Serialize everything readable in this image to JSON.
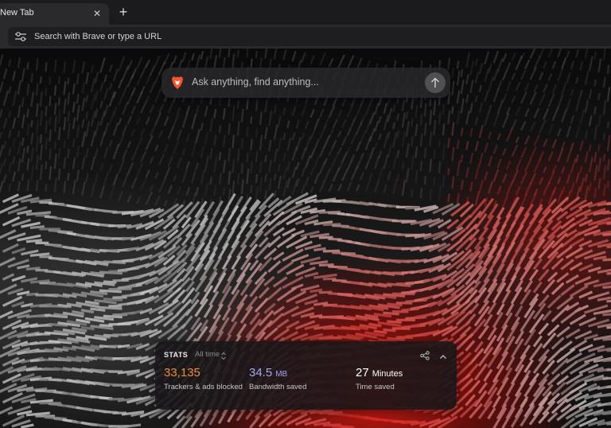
{
  "tab": {
    "title": "New Tab",
    "close_glyph": "✕",
    "new_tab_glyph": "+"
  },
  "address_bar": {
    "placeholder": "Search with Brave or type a URL",
    "icon": "site-settings-icon"
  },
  "search": {
    "placeholder": "Ask anything, find anything...",
    "logo_icon": "brave-logo-icon",
    "submit_icon": "arrow-up-icon"
  },
  "stats": {
    "heading": "STATS",
    "range": "All time",
    "items": [
      {
        "value": "33,135",
        "unit": "",
        "label": "Trackers & ads blocked",
        "color": "#f08a3a"
      },
      {
        "value": "34.5",
        "unit": "MB",
        "label": "Bandwidth saved",
        "color": "#a7a4f2"
      },
      {
        "value": "27",
        "unit": "Minutes",
        "label": "Time saved",
        "color": "#ffffff"
      }
    ],
    "share_icon": "share-icon",
    "collapse_icon": "chevron-up-icon"
  },
  "colors": {
    "accent_red": "#e0261a",
    "brave_orange": "#fb542b"
  }
}
